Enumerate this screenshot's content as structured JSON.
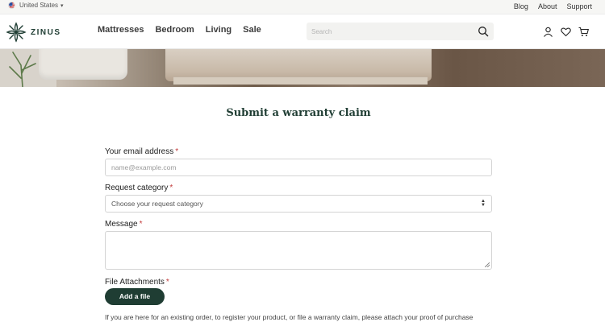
{
  "utility": {
    "locale": "United States",
    "links": [
      "Blog",
      "About",
      "Support"
    ]
  },
  "brand": {
    "name": "ZINUS"
  },
  "nav": {
    "items": [
      "Mattresses",
      "Bedroom",
      "Living",
      "Sale"
    ],
    "search_placeholder": "Search"
  },
  "icons": [
    "account-icon",
    "wishlist-heart-icon",
    "cart-icon",
    "search-icon",
    "chevron-down-icon"
  ],
  "colors": {
    "brand_green": "#1f3d33",
    "required": "#c23a3a"
  },
  "form": {
    "title": "Submit a warranty claim",
    "email": {
      "label": "Your email address",
      "required_mark": "*",
      "placeholder": "name@example.com"
    },
    "category": {
      "label": "Request category",
      "required_mark": "*",
      "selected": "Choose your request category"
    },
    "message": {
      "label": "Message",
      "required_mark": "*"
    },
    "attachments": {
      "label": "File Attachments",
      "required_mark": "*",
      "button": "Add a file"
    },
    "note": "If you are here for an existing order, to register your product, or file a warranty claim, please attach your proof of purchase"
  }
}
